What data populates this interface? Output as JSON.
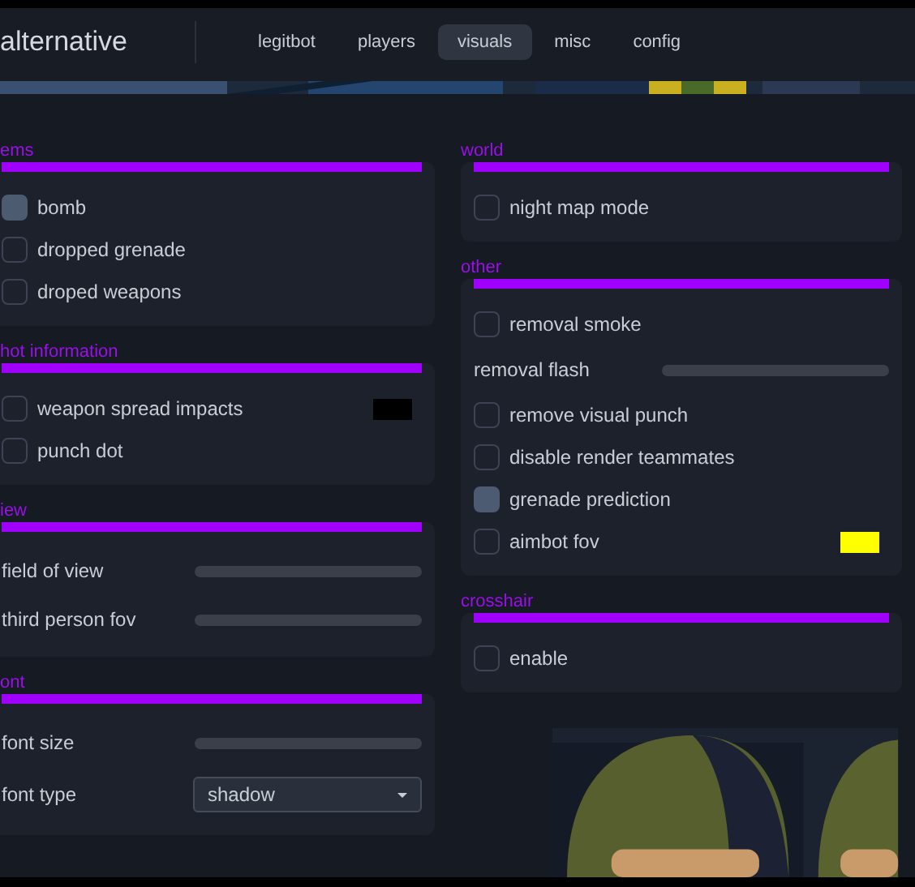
{
  "app": {
    "title": "alternative"
  },
  "tabs": [
    {
      "label": "legitbot",
      "selected": false
    },
    {
      "label": "players",
      "selected": false
    },
    {
      "label": "visuals",
      "selected": true
    },
    {
      "label": "misc",
      "selected": false
    },
    {
      "label": "config",
      "selected": false
    }
  ],
  "columns": [
    {
      "sections": [
        {
          "title": "ems",
          "rows": [
            {
              "kind": "checkbox",
              "label": "bomb",
              "checked": true
            },
            {
              "kind": "checkbox",
              "label": "dropped grenade",
              "checked": false
            },
            {
              "kind": "checkbox",
              "label": "droped weapons",
              "checked": false
            }
          ]
        },
        {
          "title": "hot information",
          "rows": [
            {
              "kind": "checkbox",
              "label": "weapon spread impacts",
              "checked": false,
              "color": "#000000"
            },
            {
              "kind": "checkbox",
              "label": "punch dot",
              "checked": false
            }
          ]
        },
        {
          "title": "iew",
          "rows": [
            {
              "kind": "slider",
              "label": "field of view",
              "level": 0
            },
            {
              "kind": "slider",
              "label": "third person fov",
              "level": 0
            }
          ]
        },
        {
          "title": "ont",
          "rows": [
            {
              "kind": "slider",
              "label": "font size",
              "level": 0
            },
            {
              "kind": "dropdown",
              "label": "font type",
              "value": "shadow"
            }
          ]
        }
      ]
    },
    {
      "sections": [
        {
          "title": "world",
          "rows": [
            {
              "kind": "checkbox",
              "label": "night map mode",
              "checked": false
            }
          ]
        },
        {
          "title": "other",
          "rows": [
            {
              "kind": "checkbox",
              "label": "removal smoke",
              "checked": false
            },
            {
              "kind": "slider",
              "label": "removal flash",
              "level": 0
            },
            {
              "kind": "checkbox",
              "label": "remove visual punch",
              "checked": false
            },
            {
              "kind": "checkbox",
              "label": "disable render teammates",
              "checked": false
            },
            {
              "kind": "checkbox",
              "label": "grenade prediction",
              "checked": true
            },
            {
              "kind": "checkbox",
              "label": "aimbot fov",
              "checked": false,
              "color": "#ffff00"
            }
          ]
        },
        {
          "title": "crosshair",
          "rows": [
            {
              "kind": "checkbox",
              "label": "enable",
              "checked": false
            }
          ]
        }
      ]
    }
  ]
}
